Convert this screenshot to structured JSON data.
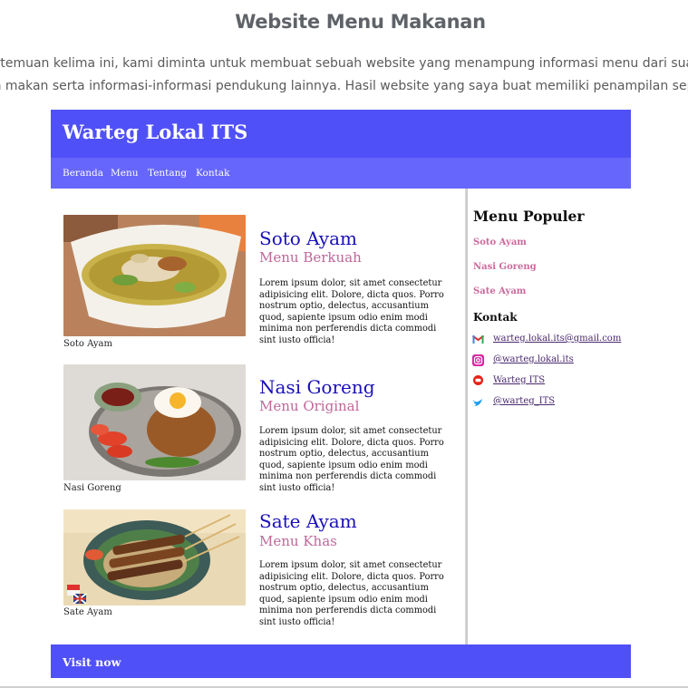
{
  "article": {
    "title": "Website Menu Makanan",
    "intro_line1": "ertemuan kelima ini, kami diminta untuk membuat sebuah website yang menampung informasi menu dari suatu",
    "intro_line2": "ah makan serta informasi-informasi pendukung lainnya. Hasil website yang saya buat memiliki penampilan seperti"
  },
  "site": {
    "title": "Warteg Lokal ITS",
    "nav": [
      "Beranda",
      "Menu",
      "Tentang",
      "Kontak"
    ],
    "menu_items": [
      {
        "image_icon": "soto-ayam-photo",
        "caption": "Soto Ayam",
        "name": "Soto Ayam",
        "subtitle": "Menu Berkuah",
        "description": "Lorem ipsum dolor, sit amet consectetur adipisicing elit. Dolore, dicta quos. Porro nostrum optio, delectus, accusantium quod, sapiente ipsum odio enim modi minima non perferendis dicta commodi sint iusto officia!"
      },
      {
        "image_icon": "nasi-goreng-photo",
        "caption": "Nasi Goreng",
        "name": "Nasi Goreng",
        "subtitle": "Menu Original",
        "description": "Lorem ipsum dolor, sit amet consectetur adipisicing elit. Dolore, dicta quos. Porro nostrum optio, delectus, accusantium quod, sapiente ipsum odio enim modi minima non perferendis dicta commodi sint iusto officia!"
      },
      {
        "image_icon": "sate-ayam-photo",
        "caption": "Sate Ayam",
        "name": "Sate Ayam",
        "subtitle": "Menu Khas",
        "description": "Lorem ipsum dolor, sit amet consectetur adipisicing elit. Dolore, dicta quos. Porro nostrum optio, delectus, accusantium quod, sapiente ipsum odio enim modi minima non perferendis dicta commodi sint iusto officia!"
      }
    ],
    "sidebar": {
      "popular_title": "Menu Populer",
      "popular": [
        "Soto Ayam",
        "Nasi Goreng",
        "Sate Ayam"
      ],
      "contact_title": "Kontak",
      "contacts": [
        {
          "icon": "gmail-icon",
          "label": "warteg.lokal.its@gmail.com"
        },
        {
          "icon": "instagram-icon",
          "label": "@warteg.lokal.its"
        },
        {
          "icon": "youtube-icon",
          "label": "Warteg ITS"
        },
        {
          "icon": "twitter-icon",
          "label": "@warteg_ITS"
        }
      ]
    },
    "footer_link": "Visit now"
  },
  "colors": {
    "header": "#5050f8",
    "nav": "#6666fc",
    "dish_name": "#1a10b8",
    "dish_sub": "#c0679a",
    "popular_link": "#cc6a9c"
  }
}
